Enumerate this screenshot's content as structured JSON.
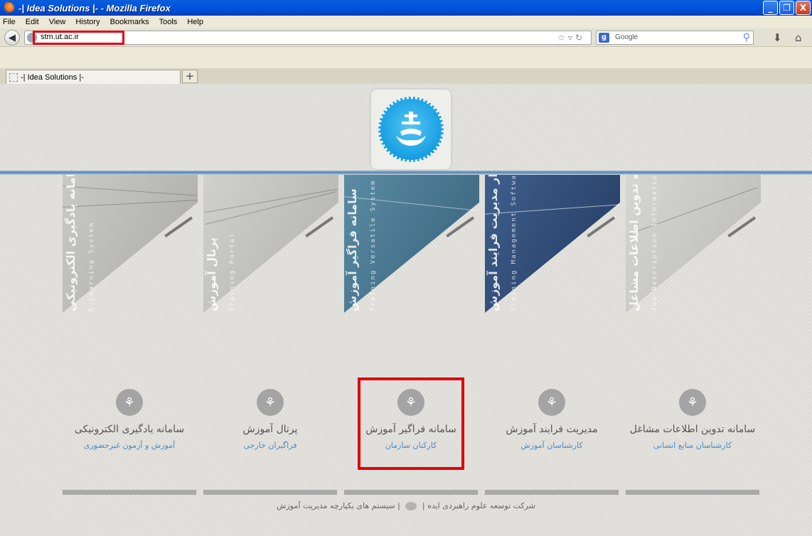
{
  "window": {
    "title": "-| Idea Solutions |- - Mozilla Firefox",
    "buttons": {
      "minimize": "_",
      "maximize": "❐",
      "close": "X"
    }
  },
  "menubar": {
    "items": [
      {
        "label": "File"
      },
      {
        "label": "Edit"
      },
      {
        "label": "View"
      },
      {
        "label": "History"
      },
      {
        "label": "Bookmarks"
      },
      {
        "label": "Tools"
      },
      {
        "label": "Help"
      }
    ]
  },
  "navbar": {
    "url": "stm.ut.ac.ir",
    "search_engine": "g",
    "search_placeholder": "Google"
  },
  "tabs": [
    {
      "label": "-| Idea Solutions |-"
    }
  ],
  "page": {
    "banners": [
      {
        "title": "سامانه یادگیری الکترونیکی",
        "subtitle": "E-Learning System",
        "color": "#b7b7b4"
      },
      {
        "title": "پرتال آموزش",
        "subtitle": "Training Portal",
        "color": "#bcbcb9"
      },
      {
        "title": "سامانه فراگیر آموزش",
        "subtitle": "Training Versatile System",
        "color": "#4a7b95"
      },
      {
        "title": "نرم افزار مدیریت فرایند آموزش",
        "subtitle": "Training Management Software",
        "color": "#2f4c76"
      },
      {
        "title": "سامانه تدوین اطلاعات مشاغل",
        "subtitle": "Job Description Information Development System",
        "color": "#c5c5c2"
      }
    ],
    "items": [
      {
        "title": "سامانه یادگیری الکترونیکی",
        "subtitle": "آموزش و آزمون غیرحضوری"
      },
      {
        "title": "پرتال آموزش",
        "subtitle": "فراگیران خارجی"
      },
      {
        "title": "سامانه فراگیر آموزش",
        "subtitle": "کارکنان سازمان"
      },
      {
        "title": "مدیریت فرایند آموزش",
        "subtitle": "کارشناسان آموزش"
      },
      {
        "title": "سامانه تدوین اطلاعات مشاغل",
        "subtitle": "کارشناسان منابع انسانی"
      }
    ],
    "footer": {
      "left": "شرکت توسعه علوم راهبردی ایده",
      "right": "سیستم های یکپارچه مدیریت آموزش",
      "separator": "|"
    },
    "colors": {
      "accent_link": "#4d8ac7",
      "highlight": "#e0000c",
      "divider": "#5b86ad"
    }
  }
}
